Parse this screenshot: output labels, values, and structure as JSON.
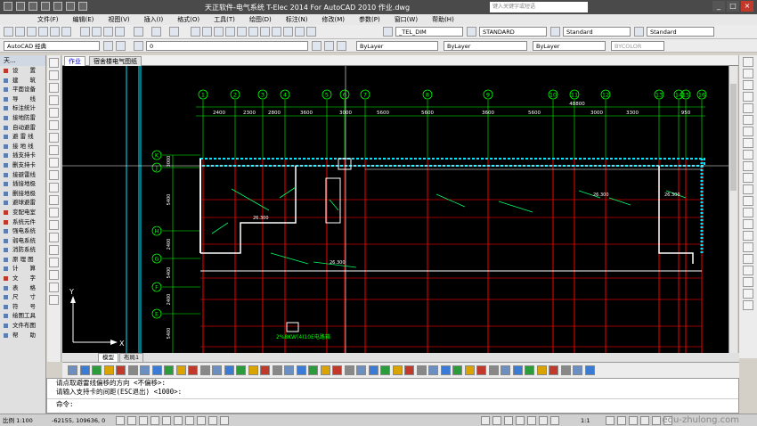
{
  "titlebar": {
    "title": "天正软件-电气系统 T-Elec 2014  For AutoCAD 2010      作业.dwg",
    "search_placeholder": "键入关键字或短语",
    "win_min": "_",
    "win_max": "□",
    "win_close": "×"
  },
  "menu": [
    "文件(F)",
    "编辑(E)",
    "视图(V)",
    "插入(I)",
    "格式(O)",
    "工具(T)",
    "绘图(D)",
    "标注(N)",
    "修改(M)",
    "参数(P)",
    "窗口(W)",
    "帮助(H)"
  ],
  "toolbar1": {
    "style_text": "_TEL_DIM",
    "dimstyle": "STANDARD",
    "tablestyle": "Standard",
    "mlstyle": "Standard"
  },
  "toolbar2": {
    "workspace": "AutoCAD 经典",
    "layer": "0",
    "color": "ByLayer",
    "linetype": "ByLayer",
    "lineweight": "ByLayer",
    "plotstyle": "BYCOLOR"
  },
  "leftpanel": {
    "title": "天...",
    "items": [
      {
        "label": "设　　置",
        "head": true
      },
      {
        "label": "建　　筑",
        "head": false
      },
      {
        "label": "平面设备",
        "head": false
      },
      {
        "label": "导　　线",
        "head": false
      },
      {
        "label": "标注统计",
        "head": false
      },
      {
        "label": "接地防雷",
        "head": false
      },
      {
        "label": "自动避雷",
        "head": false
      },
      {
        "label": "避 雷 线",
        "head": false
      },
      {
        "label": "接 地 线",
        "head": false
      },
      {
        "label": "插支持卡",
        "head": false
      },
      {
        "label": "删支持卡",
        "head": false
      },
      {
        "label": "接避雷线",
        "head": false
      },
      {
        "label": "插接地极",
        "head": false
      },
      {
        "label": "删接地极",
        "head": false
      },
      {
        "label": "避球避雷",
        "head": false
      },
      {
        "label": "变配电室",
        "head": true
      },
      {
        "label": "系统元件",
        "head": true
      },
      {
        "label": "强电系统",
        "head": false
      },
      {
        "label": "弱电系统",
        "head": false
      },
      {
        "label": "消防系统",
        "head": false
      },
      {
        "label": "原 理 图",
        "head": false
      },
      {
        "label": "计　　算",
        "head": false
      },
      {
        "label": "文　　字",
        "head": true
      },
      {
        "label": "表　　格",
        "head": false
      },
      {
        "label": "尺　　寸",
        "head": false
      },
      {
        "label": "符　　号",
        "head": false
      },
      {
        "label": "绘图工具",
        "head": false
      },
      {
        "label": "文件布图",
        "head": false
      },
      {
        "label": "帮　　助",
        "head": false
      }
    ]
  },
  "tabs": [
    {
      "label": "作业",
      "active": true
    },
    {
      "label": "宿舍楼电气图纸",
      "active": false
    }
  ],
  "drawing": {
    "columns": [
      "1",
      "2",
      "3",
      "4",
      "5",
      "6",
      "7",
      "8",
      "9",
      "10",
      "11",
      "12",
      "13",
      "14",
      "15",
      "16"
    ],
    "rows": [
      "K",
      "J",
      "H",
      "G",
      "F",
      "E"
    ],
    "top_dims": [
      "2400",
      "2300",
      "2800",
      "3600",
      "3000",
      "5600",
      "5600",
      "3600",
      "5600",
      "3000",
      "3300",
      "950"
    ],
    "total": "48800",
    "left_dims": [
      "3000",
      "5400",
      "2400",
      "5400",
      "2400",
      "5400"
    ],
    "callouts": [
      "26.300",
      "26.300",
      "26.300",
      "26.300"
    ],
    "label_bottom": "2%8KW(4)10E电路箱",
    "ucs_y": "Y",
    "ucs_x": "X"
  },
  "layouttabs": {
    "model": "模型",
    "layout1": "布局1"
  },
  "command": {
    "line1": "请点取避雷线偏移的方向 <不偏移>:",
    "line2": "请输入支持卡的间距(ESC退出) <1000>:",
    "prompt": "命令:"
  },
  "status": {
    "scale": "比例 1:100",
    "coords": "-62155, 109636, 0",
    "annoscale": "1:1",
    "watermark": "edu-zhulong.com"
  },
  "colors": {
    "canvas": "#000000",
    "axis": "#00ff00",
    "wall": "#ffffff",
    "dim": "#00ff00",
    "grid": "#ff0000"
  }
}
